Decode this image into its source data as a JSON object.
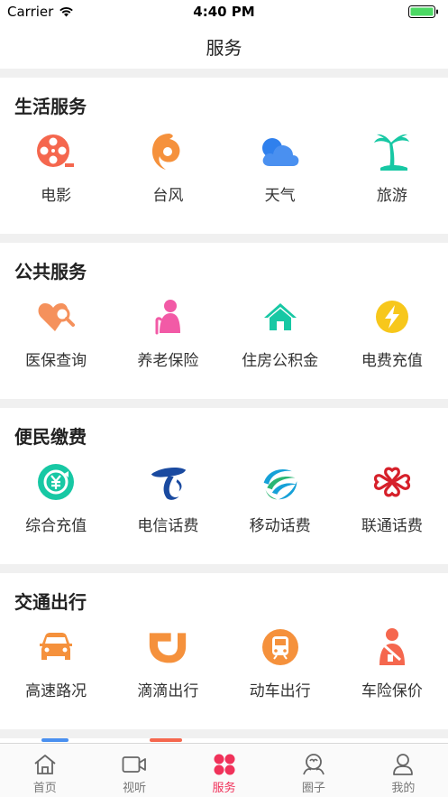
{
  "status": {
    "carrier": "Carrier",
    "time": "4:40 PM"
  },
  "nav": {
    "title": "服务"
  },
  "sections": [
    {
      "title": "生活服务",
      "items": [
        {
          "label": "电影",
          "icon": "film-reel-icon",
          "color": "#f5674e"
        },
        {
          "label": "台风",
          "icon": "typhoon-icon",
          "color": "#f5913c"
        },
        {
          "label": "天气",
          "icon": "cloud-icon",
          "color": "#2f80ed"
        },
        {
          "label": "旅游",
          "icon": "palm-tree-icon",
          "color": "#17c8a4"
        }
      ]
    },
    {
      "title": "公共服务",
      "items": [
        {
          "label": "医保查询",
          "icon": "heart-search-icon",
          "color": "#f5915c"
        },
        {
          "label": "养老保险",
          "icon": "elderly-icon",
          "color": "#f25aa6"
        },
        {
          "label": "住房公积金",
          "icon": "house-icon",
          "color": "#17c8a4"
        },
        {
          "label": "电费充值",
          "icon": "lightning-icon",
          "color": "#f7c71b"
        }
      ]
    },
    {
      "title": "便民缴费",
      "items": [
        {
          "label": "综合充值",
          "icon": "yuan-refresh-icon",
          "color": "#17c8a4"
        },
        {
          "label": "电信话费",
          "icon": "china-telecom-logo-icon",
          "color": "#1a4aa0"
        },
        {
          "label": "移动话费",
          "icon": "china-mobile-logo-icon",
          "color": "#16a1d8"
        },
        {
          "label": "联通话费",
          "icon": "china-unicom-logo-icon",
          "color": "#d6202a"
        }
      ]
    },
    {
      "title": "交通出行",
      "items": [
        {
          "label": "高速路况",
          "icon": "car-icon",
          "color": "#f5913c"
        },
        {
          "label": "滴滴出行",
          "icon": "didi-logo-icon",
          "color": "#f5913c"
        },
        {
          "label": "动车出行",
          "icon": "train-icon",
          "color": "#f5913c"
        },
        {
          "label": "车险保价",
          "icon": "injured-person-icon",
          "color": "#f5674e"
        }
      ]
    }
  ],
  "tabs": [
    {
      "label": "首页",
      "icon": "home-icon",
      "active": false
    },
    {
      "label": "视听",
      "icon": "video-camera-icon",
      "active": false
    },
    {
      "label": "服务",
      "icon": "service-grid-icon",
      "active": true
    },
    {
      "label": "圈子",
      "icon": "community-icon",
      "active": false
    },
    {
      "label": "我的",
      "icon": "profile-icon",
      "active": false
    }
  ],
  "colors": {
    "accent": "#f0325a",
    "separator": "#f0f0f0"
  }
}
